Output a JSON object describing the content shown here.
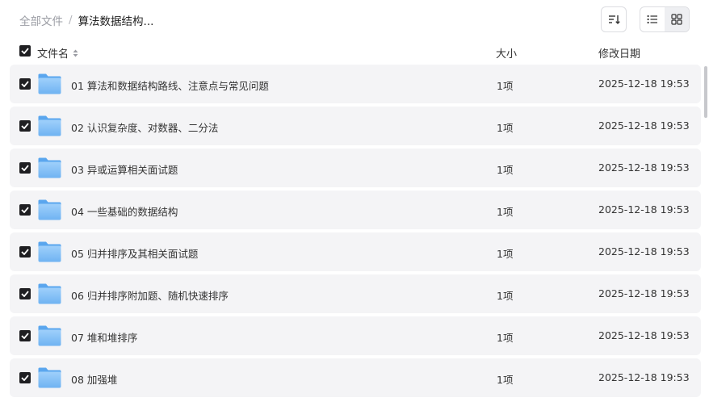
{
  "breadcrumb": {
    "root": "全部文件",
    "separator": "/",
    "current": "算法数据结构..."
  },
  "columns": {
    "name": "文件名",
    "size": "大小",
    "date": "修改日期"
  },
  "icons": {
    "sort": "sort-descending-icon",
    "list_view": "list-view-icon",
    "grid_view": "grid-view-icon",
    "folder": "folder-icon",
    "checkbox": "checkbox-checked-icon"
  },
  "colors": {
    "row_bg": "#f4f4f6",
    "checkbox": "#1f1f22",
    "folder": "#7dbcf5"
  },
  "files": [
    {
      "name": "01 算法和数据结构路线、注意点与常见问题",
      "size": "1项",
      "date": "2025-12-18 19:53"
    },
    {
      "name": "02 认识复杂度、对数器、二分法",
      "size": "1项",
      "date": "2025-12-18 19:53"
    },
    {
      "name": "03 异或运算相关面试题",
      "size": "1项",
      "date": "2025-12-18 19:53"
    },
    {
      "name": "04 一些基础的数据结构",
      "size": "1项",
      "date": "2025-12-18 19:53"
    },
    {
      "name": "05 归并排序及其相关面试题",
      "size": "1项",
      "date": "2025-12-18 19:53"
    },
    {
      "name": "06 归并排序附加题、随机快速排序",
      "size": "1项",
      "date": "2025-12-18 19:53"
    },
    {
      "name": "07 堆和堆排序",
      "size": "1项",
      "date": "2025-12-18 19:53"
    },
    {
      "name": "08 加强堆",
      "size": "1项",
      "date": "2025-12-18 19:53"
    }
  ]
}
